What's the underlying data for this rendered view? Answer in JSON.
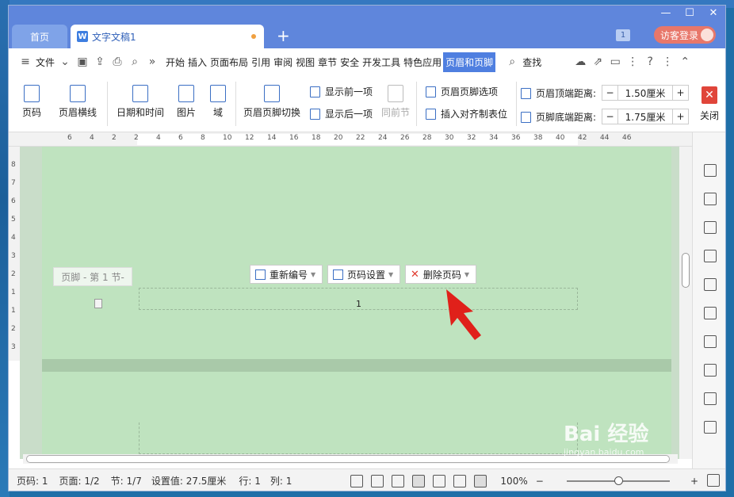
{
  "tabs": {
    "home": "首页",
    "doc": "文字文稿1",
    "new": "+"
  },
  "titlebar": {
    "badge": "1",
    "login": "访客登录",
    "min": "—",
    "max": "☐",
    "close": "✕"
  },
  "menu": {
    "file": "文件",
    "items": [
      "开始",
      "插入",
      "页面布局",
      "引用",
      "审阅",
      "视图",
      "章节",
      "安全",
      "开发工具",
      "特色应用",
      "页眉和页脚"
    ],
    "search": "查找"
  },
  "ribbon": {
    "page_number": "页码",
    "header_line": "页眉横线",
    "date_time": "日期和时间",
    "picture": "图片",
    "field": "域",
    "switch_header_footer": "页眉页脚切换",
    "show_prev": "显示前一项",
    "show_next": "显示后一项",
    "same_as_prev": "同前节",
    "header_footer_options": "页眉页脚选项",
    "insert_align_tab": "插入对齐制表位",
    "header_top_label": "页眉顶端距离:",
    "header_top_value": "1.50厘米",
    "footer_bottom_label": "页脚底端距离:",
    "footer_bottom_value": "1.75厘米",
    "close": "关闭"
  },
  "ruler": {
    "numbers": [
      "6",
      "4",
      "2",
      "2",
      "4",
      "6",
      "8",
      "10",
      "12",
      "14",
      "16",
      "18",
      "20",
      "22",
      "24",
      "26",
      "28",
      "30",
      "32",
      "34",
      "36",
      "38",
      "40",
      "42",
      "44",
      "46"
    ]
  },
  "vruler": {
    "numbers": [
      "8",
      "7",
      "6",
      "5",
      "4",
      "3",
      "2",
      "1",
      "1",
      "2",
      "3"
    ]
  },
  "doc": {
    "footer_label": "页脚 - 第 1 节-",
    "renumber": "重新编号",
    "page_number_settings": "页码设置",
    "delete_page_number": "删除页码",
    "page_number_value": "1"
  },
  "status": {
    "page_num": "页码: 1",
    "pages": "页面: 1/2",
    "section": "节: 1/7",
    "setting": "设置值: 27.5厘米",
    "row": "行: 1",
    "col": "列: 1",
    "zoom": "100%",
    "zoom_minus": "−",
    "zoom_plus": "+"
  },
  "watermark": {
    "main": "Bai 经验",
    "sub": "jingyan.baidu.com"
  },
  "colors": {
    "titlebar": "#5f86dc",
    "active_tab": "#4f7fe0",
    "page_bg": "#bfe3bf",
    "arrow": "#e0201a",
    "login": "#e8776a"
  }
}
